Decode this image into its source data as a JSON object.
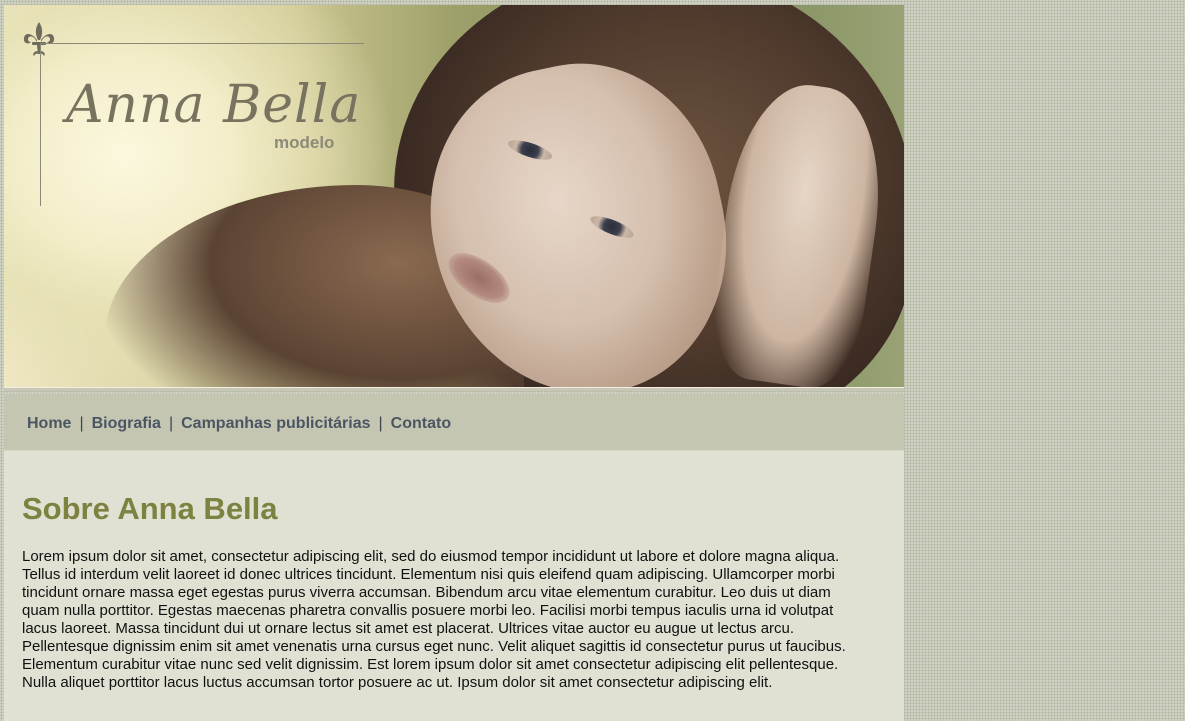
{
  "header": {
    "logo_name": "Anna Bella",
    "logo_subtitle": "modelo",
    "logo_icon": "fleur-de-lis-icon",
    "banner_image": "portrait photo of a woman with long brown hair"
  },
  "nav": {
    "items": [
      {
        "label": "Home"
      },
      {
        "label": "Biografia"
      },
      {
        "label": "Campanhas publicitárias"
      },
      {
        "label": "Contato"
      }
    ],
    "separator": "|"
  },
  "main": {
    "title": "Sobre Anna Bella",
    "body": "Lorem ipsum dolor sit amet, consectetur adipiscing elit, sed do eiusmod tempor incididunt ut labore et dolore magna aliqua. Tellus id interdum velit laoreet id donec ultrices tincidunt. Elementum nisi quis eleifend quam adipiscing. Ullamcorper morbi tincidunt ornare massa eget egestas purus viverra accumsan. Bibendum arcu vitae elementum curabitur. Leo duis ut diam quam nulla porttitor. Egestas maecenas pharetra convallis posuere morbi leo. Facilisi morbi tempus iaculis urna id volutpat lacus laoreet. Massa tincidunt dui ut ornare lectus sit amet est placerat. Ultrices vitae auctor eu augue ut lectus arcu. Pellentesque dignissim enim sit amet venenatis urna cursus eget nunc. Velit aliquet sagittis id consectetur purus ut faucibus. Elementum curabitur vitae nunc sed velit dignissim. Est lorem ipsum dolor sit amet consectetur adipiscing elit pellentesque. Nulla aliquet porttitor lacus luctus accumsan tortor posuere ac ut. Ipsum dolor sit amet consectetur adipiscing elit."
  },
  "colors": {
    "page_background": "#cfd1c2",
    "nav_background": "#c4c6b2",
    "content_background": "#e0e1d3",
    "heading": "#7d8241",
    "nav_text": "#4b5663",
    "logo_text": "#77735f"
  }
}
